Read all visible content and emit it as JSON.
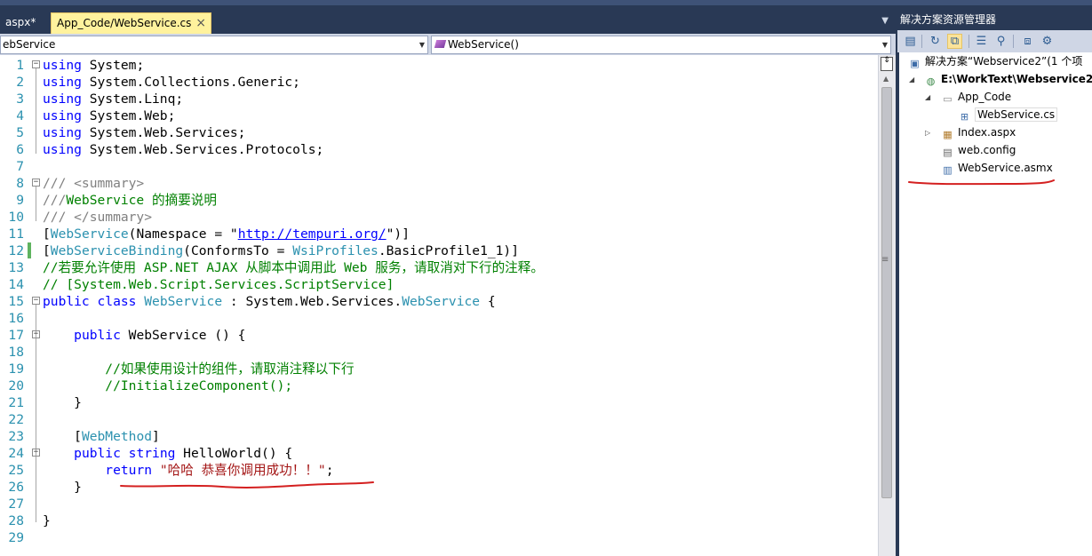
{
  "tabs": [
    {
      "label": "aspx*",
      "active": false
    },
    {
      "label": "App_Code/WebService.cs",
      "active": true,
      "close": "×"
    }
  ],
  "nav": {
    "type_combo": "ebService",
    "member_combo": "WebService()"
  },
  "editor": {
    "lines": [
      {
        "n": "1"
      },
      {
        "n": "2"
      },
      {
        "n": "3"
      },
      {
        "n": "4"
      },
      {
        "n": "5"
      },
      {
        "n": "6"
      },
      {
        "n": "7"
      },
      {
        "n": "8"
      },
      {
        "n": "9"
      },
      {
        "n": "10"
      },
      {
        "n": "11"
      },
      {
        "n": "12"
      },
      {
        "n": "13"
      },
      {
        "n": "14"
      },
      {
        "n": "15"
      },
      {
        "n": "16"
      },
      {
        "n": "17"
      },
      {
        "n": "18"
      },
      {
        "n": "19"
      },
      {
        "n": "20"
      },
      {
        "n": "21"
      },
      {
        "n": "22"
      },
      {
        "n": "23"
      },
      {
        "n": "24"
      },
      {
        "n": "25"
      },
      {
        "n": "26"
      },
      {
        "n": "27"
      },
      {
        "n": "28"
      },
      {
        "n": "29"
      }
    ],
    "code": {
      "using": "using",
      "l1": " System;",
      "l2": " System.Collections.Generic;",
      "l3": " System.Linq;",
      "l4": " System.Web;",
      "l5": " System.Web.Services;",
      "l6": " System.Web.Services.Protocols;",
      "l8": "/// <summary>",
      "l9a": "///",
      "l9b": "WebService 的摘要说明",
      "l10": "/// </summary>",
      "l11_open": "[",
      "l11_attr": "WebService",
      "l11_mid": "(Namespace = \"",
      "l11_url": "http://tempuri.org/",
      "l11_end": "\")]",
      "l12_open": "[",
      "l12_attr": "WebServiceBinding",
      "l12_mid": "(ConformsTo = ",
      "l12_type": "WsiProfiles",
      "l12_end": ".BasicProfile1_1)]",
      "l13": "//若要允许使用 ASP.NET AJAX 从脚本中调用此 Web 服务，请取消对下行的注释。",
      "l14": "// [System.Web.Script.Services.ScriptService]",
      "l15_public": "public",
      "l15_class": "class",
      "l15_name": "WebService",
      "l15_mid": " : System.Web.Services.",
      "l15_base": "WebService",
      "l15_end": " {",
      "l17_public": "public",
      "l17_rest": " WebService () {",
      "l19": "//如果使用设计的组件，请取消注释以下行",
      "l20": "//InitializeComponent();",
      "l21": "}",
      "l23_open": "[",
      "l23_attr": "WebMethod",
      "l23_end": "]",
      "l24_public": "public",
      "l24_string": "string",
      "l24_rest": " HelloWorld() {",
      "l25_return": "return",
      "l25_str": "\"哈哈 恭喜你调用成功！！\"",
      "l25_end": ";",
      "l26": "}",
      "l28": "}"
    }
  },
  "solution_explorer": {
    "title": "解决方案资源管理器",
    "solution": "解决方案“Webservice2”(1 个项",
    "project": "E:\\WorkText\\Webservice2\\",
    "folder": "App_Code",
    "file_cs": "WebService.cs",
    "file_index": "Index.aspx",
    "file_config": "web.config",
    "file_asmx": "WebService.asmx"
  },
  "colors": {
    "keyword": "#0000ff",
    "type": "#2b91af",
    "comment": "#008000",
    "string": "#a31515",
    "annotation": "#d42020"
  }
}
